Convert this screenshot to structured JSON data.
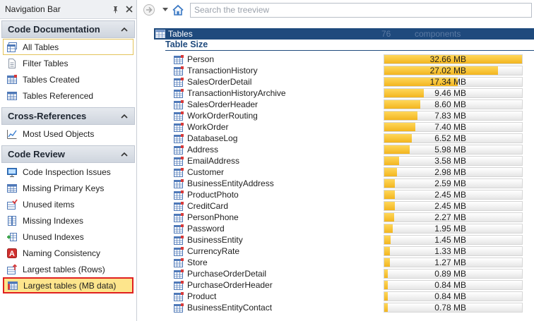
{
  "nav": {
    "title": "Navigation Bar",
    "groups": [
      {
        "title": "Code Documentation",
        "items": [
          {
            "label": "All Tables",
            "icon": "all-tables-icon"
          },
          {
            "label": "Filter Tables",
            "icon": "filter-tables-icon"
          },
          {
            "label": "Tables Created",
            "icon": "tables-created-icon"
          },
          {
            "label": "Tables Referenced",
            "icon": "tables-referenced-icon"
          }
        ]
      },
      {
        "title": "Cross-References",
        "items": [
          {
            "label": "Most Used Objects",
            "icon": "most-used-chart-icon"
          }
        ]
      },
      {
        "title": "Code Review",
        "items": [
          {
            "label": "Code Inspection Issues",
            "icon": "code-inspection-icon"
          },
          {
            "label": "Missing Primary Keys",
            "icon": "missing-primary-keys-icon"
          },
          {
            "label": "Unused items",
            "icon": "unused-items-icon"
          },
          {
            "label": "Missing Indexes",
            "icon": "missing-indexes-icon"
          },
          {
            "label": "Unused Indexes",
            "icon": "unused-indexes-icon"
          },
          {
            "label": "Naming Consistency",
            "icon": "naming-consistency-icon"
          },
          {
            "label": "Largest tables (Rows)",
            "icon": "largest-rows-icon"
          },
          {
            "label": "Largest tables (MB data)",
            "icon": "largest-mb-icon"
          }
        ]
      }
    ]
  },
  "toolbar": {
    "search_placeholder": "Search the treeview"
  },
  "report": {
    "header_title": "Tables",
    "count": "76",
    "count_unit": "components",
    "section_title": "Table Size",
    "max_mb": 32.66,
    "rows": [
      {
        "name": "Person",
        "mb": 32.66,
        "value_label": "32.66 MB"
      },
      {
        "name": "TransactionHistory",
        "mb": 27.02,
        "value_label": "27.02 MB"
      },
      {
        "name": "SalesOrderDetail",
        "mb": 17.34,
        "value_label": "17.34 MB"
      },
      {
        "name": "TransactionHistoryArchive",
        "mb": 9.46,
        "value_label": "9.46 MB"
      },
      {
        "name": "SalesOrderHeader",
        "mb": 8.6,
        "value_label": "8.60 MB"
      },
      {
        "name": "WorkOrderRouting",
        "mb": 7.83,
        "value_label": "7.83 MB"
      },
      {
        "name": "WorkOrder",
        "mb": 7.4,
        "value_label": "7.40 MB"
      },
      {
        "name": "DatabaseLog",
        "mb": 6.52,
        "value_label": "6.52 MB"
      },
      {
        "name": "Address",
        "mb": 5.98,
        "value_label": "5.98 MB"
      },
      {
        "name": "EmailAddress",
        "mb": 3.58,
        "value_label": "3.58 MB"
      },
      {
        "name": "Customer",
        "mb": 2.98,
        "value_label": "2.98 MB"
      },
      {
        "name": "BusinessEntityAddress",
        "mb": 2.59,
        "value_label": "2.59 MB"
      },
      {
        "name": "ProductPhoto",
        "mb": 2.45,
        "value_label": "2.45 MB"
      },
      {
        "name": "CreditCard",
        "mb": 2.45,
        "value_label": "2.45 MB"
      },
      {
        "name": "PersonPhone",
        "mb": 2.27,
        "value_label": "2.27 MB"
      },
      {
        "name": "Password",
        "mb": 1.95,
        "value_label": "1.95 MB"
      },
      {
        "name": "BusinessEntity",
        "mb": 1.45,
        "value_label": "1.45 MB"
      },
      {
        "name": "CurrencyRate",
        "mb": 1.33,
        "value_label": "1.33 MB"
      },
      {
        "name": "Store",
        "mb": 1.27,
        "value_label": "1.27 MB"
      },
      {
        "name": "PurchaseOrderDetail",
        "mb": 0.89,
        "value_label": "0.89 MB"
      },
      {
        "name": "PurchaseOrderHeader",
        "mb": 0.84,
        "value_label": "0.84 MB"
      },
      {
        "name": "Product",
        "mb": 0.84,
        "value_label": "0.84 MB"
      },
      {
        "name": "BusinessEntityContact",
        "mb": 0.78,
        "value_label": "0.78 MB"
      }
    ]
  },
  "colors": {
    "header_bg": "#1f4a7d",
    "bar_fill": "#f3b51f",
    "selection_bg": "#fde58c",
    "selection_border": "#e02020"
  }
}
